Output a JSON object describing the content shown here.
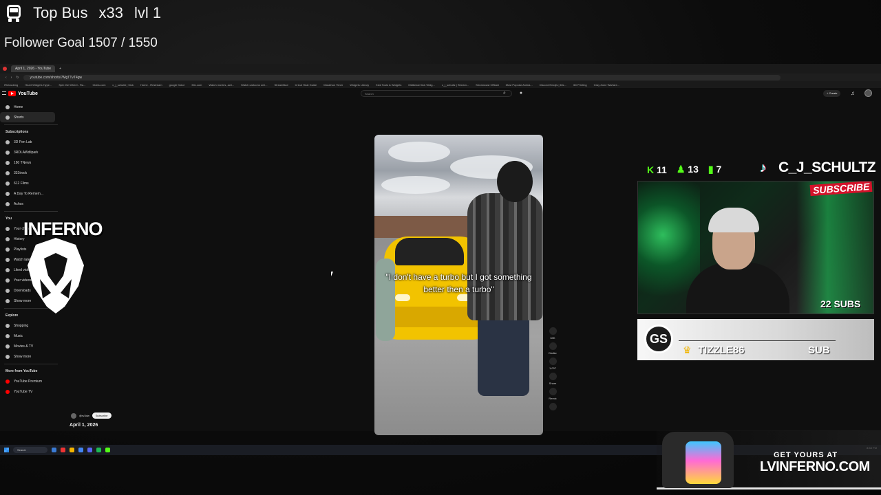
{
  "overlay": {
    "top_bus_label": "Top Bus",
    "top_bus_count": "x33",
    "top_bus_level": "lvl 1",
    "follower_goal": "Follower Goal 1507 / 1550"
  },
  "browser": {
    "tab_title": "April 1, 2026 - YouTube",
    "url": "youtube.com/shorts/7MgTTvT4gw",
    "bookmarks": [
      "IRLtracking",
      "Heart Widgets Hype...",
      "Spin the Wheel - Ra...",
      "Clubs.com",
      "c_j_schultz | Kick",
      "Home - Restream",
      "google Voice",
      "Mix.com",
      "Watch movies, acti...",
      "Watch cartoons onli...",
      "StreamBud",
      "Cricut Heat Guide",
      "Marathon Timer",
      "Widgets Library",
      "Kick Tools & Widgets",
      "Midbeast Kick Widg...",
      "c_j_schultz | Stream...",
      "Streamcast Official",
      "Most Popular Anima...",
      "Discord Emojis | Dis...",
      "3D Printing",
      "Gray Zone Warfare..."
    ]
  },
  "youtube": {
    "logo_text": "YouTube",
    "search_placeholder": "Search",
    "create_label": "+ Create",
    "sidebar_main": [
      {
        "label": "Home"
      },
      {
        "label": "Shorts"
      }
    ],
    "subscriptions_label": "Subscriptions",
    "subscriptions": [
      "3D Pen Lab",
      "3RDLAWdlipark",
      "180 TNews",
      "331trock",
      "612 Films",
      "A Day To Remem...",
      "Achos"
    ],
    "you_label": "You",
    "you_items": [
      "Your channel",
      "History",
      "Playlists",
      "Watch later",
      "Liked videos",
      "Your videos",
      "Downloads",
      "Show more"
    ],
    "explore_label": "Explore",
    "explore_items": [
      "Shopping",
      "Music",
      "Movies & TV",
      "Show more"
    ],
    "more_label": "More from YouTube",
    "more_items": [
      "YouTube Premium",
      "YouTube TV"
    ],
    "short_caption": "\"I don't have a turbo but I got something better then a turbo\"",
    "actions": [
      {
        "icon": "like-icon",
        "label": "63K"
      },
      {
        "icon": "dislike-icon",
        "label": "Dislike"
      },
      {
        "icon": "comment-icon",
        "label": "1,007"
      },
      {
        "icon": "share-icon",
        "label": "Share"
      },
      {
        "icon": "remix-icon",
        "label": "Remix"
      }
    ],
    "channel_handle": "@rv3dw",
    "subscribe_label": "Subscribe",
    "date": "April 1, 2026"
  },
  "taskbar": {
    "search_label": "Search",
    "clock": "8:58 PM"
  },
  "overlay_right": {
    "kick_count": "11",
    "followers_count": "13",
    "viewers_count": "7",
    "streamer_name": "C_J_SCHULTZ",
    "webcam_sign": "SUBSCRIBE",
    "subs_count": "22 SUBS",
    "alert_logo_text": "GS",
    "alert_user": "TIZZLE86",
    "alert_type": "SUB",
    "inferno_text": "INFERNO",
    "merch_line1": "GET YOURS AT",
    "merch_line2": "LVINFERNO.COM"
  },
  "colors": {
    "kick_green": "#53fc18",
    "youtube_red": "#ff0000",
    "alert_gold": "#f0b400"
  }
}
